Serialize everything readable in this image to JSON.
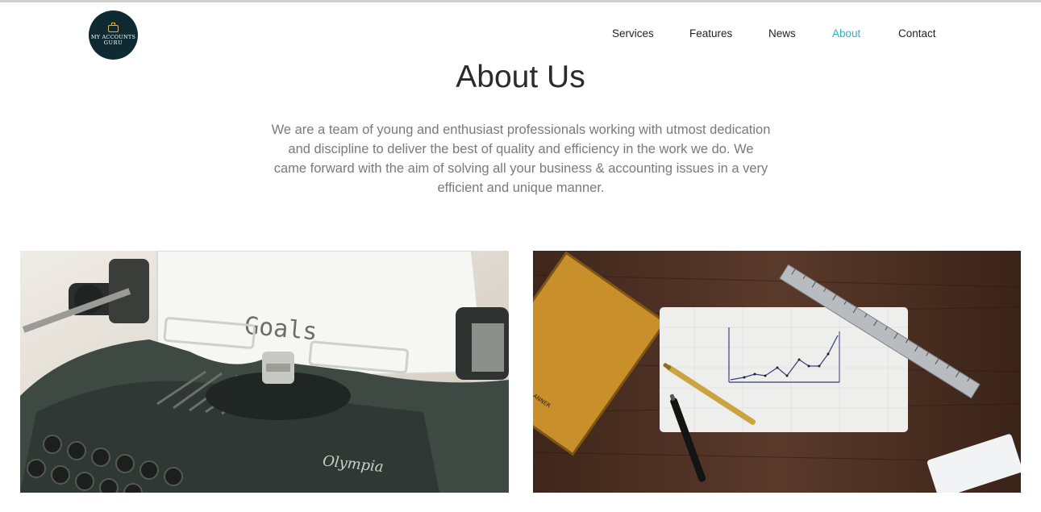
{
  "brand": {
    "logo_line1": "MY ACCOUNTS",
    "logo_line2": "GURU"
  },
  "nav": {
    "items": [
      {
        "label": "Services"
      },
      {
        "label": "Features"
      },
      {
        "label": "News"
      },
      {
        "label": "About",
        "active": true
      },
      {
        "label": "Contact"
      }
    ]
  },
  "about": {
    "title": "About Us",
    "description": "We are a team of young and enthusiast professionals working with utmost dedication and discipline to deliver the best of quality and efficiency in the work we do. We came forward with the aim of solving all your business & accounting issues in a very efficient and unique manner."
  },
  "images": {
    "typewriter": {
      "paper_text": "Goals",
      "brand_text": "Olympia"
    },
    "desk": {
      "notebook_text": "WEEKLY PLANNER"
    }
  },
  "colors": {
    "accent": "#2bb3c8",
    "logo_bg": "#0f2a33",
    "text_dark": "#2b2b2b",
    "text_muted": "#7a7a7a"
  }
}
